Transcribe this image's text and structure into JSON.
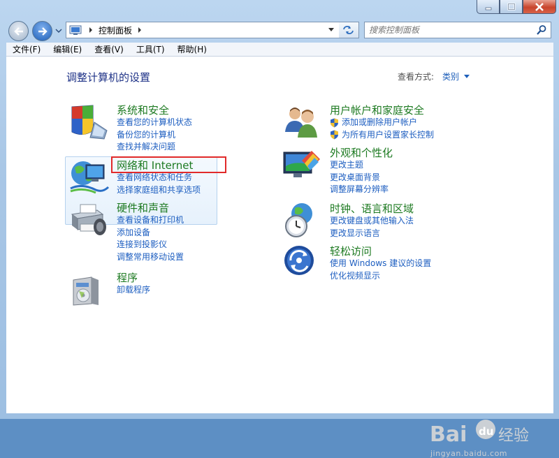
{
  "window": {
    "buttons": [
      "minimize",
      "maximize",
      "close"
    ]
  },
  "address": {
    "crumb": "控制面板",
    "search_placeholder": "搜索控制面板"
  },
  "menubar": {
    "items": [
      "文件(F)",
      "编辑(E)",
      "查看(V)",
      "工具(T)",
      "帮助(H)"
    ]
  },
  "page": {
    "title": "调整计算机的设置",
    "view_by_label": "查看方式:",
    "view_by_value": "类别"
  },
  "categories": [
    {
      "title": "系统和安全",
      "icon": "system-security-icon",
      "links": [
        "查看您的计算机状态",
        "备份您的计算机",
        "查找并解决问题"
      ]
    },
    {
      "title": "网络和 Internet",
      "icon": "network-icon",
      "links": [
        "查看网络状态和任务",
        "选择家庭组和共享选项"
      ]
    },
    {
      "title": "硬件和声音",
      "icon": "hardware-sound-icon",
      "links": [
        "查看设备和打印机",
        "添加设备",
        "连接到投影仪",
        "调整常用移动设置"
      ]
    },
    {
      "title": "程序",
      "icon": "programs-icon",
      "links": [
        "卸载程序"
      ]
    },
    {
      "title": "用户帐户和家庭安全",
      "icon": "user-accounts-icon",
      "links": [
        "添加或删除用户帐户",
        "为所有用户设置家长控制"
      ]
    },
    {
      "title": "外观和个性化",
      "icon": "appearance-icon",
      "links": [
        "更改主题",
        "更改桌面背景",
        "调整屏幕分辨率"
      ]
    },
    {
      "title": "时钟、语言和区域",
      "icon": "clock-language-icon",
      "links": [
        "更改键盘或其他输入法",
        "更改显示语言"
      ]
    },
    {
      "title": "轻松访问",
      "icon": "ease-of-access-icon",
      "links": [
        "使用 Windows 建议的设置",
        "优化视频显示"
      ]
    }
  ],
  "watermark": {
    "text": "Bai du 经验",
    "url": "jingyan.baidu.com"
  },
  "colors": {
    "link": "#1d5ec0",
    "category_title": "#1d7a21",
    "page_title": "#1e3287",
    "highlight_box": "#e12a2a"
  }
}
